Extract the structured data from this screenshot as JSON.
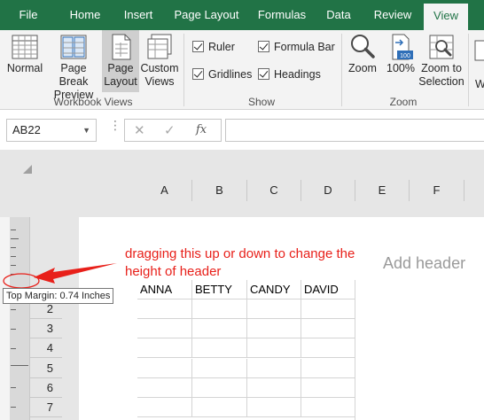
{
  "tabs": [
    {
      "label": "File"
    },
    {
      "label": "Home"
    },
    {
      "label": "Insert"
    },
    {
      "label": "Page Layout"
    },
    {
      "label": "Formulas"
    },
    {
      "label": "Data"
    },
    {
      "label": "Review"
    },
    {
      "label": "View",
      "active": true
    }
  ],
  "ribbon": {
    "workbook_views": {
      "group_label": "Workbook Views",
      "normal": {
        "line1": "Normal",
        "line2": ""
      },
      "page_break": {
        "line1": "Page Break",
        "line2": "Preview"
      },
      "page_layout": {
        "line1": "Page",
        "line2": "Layout"
      },
      "custom_views": {
        "line1": "Custom",
        "line2": "Views"
      }
    },
    "show": {
      "group_label": "Show",
      "ruler": "Ruler",
      "formula_bar": "Formula Bar",
      "gridlines": "Gridlines",
      "headings": "Headings"
    },
    "zoom": {
      "group_label": "Zoom",
      "zoom": "Zoom",
      "hundred": "100%",
      "zoom_sel": {
        "line1": "Zoom to",
        "line2": "Selection"
      },
      "badge": "100"
    }
  },
  "formula_bar": {
    "name_box": "AB22",
    "fx": "fx",
    "value": ""
  },
  "sheet": {
    "columns": [
      "A",
      "B",
      "C",
      "D",
      "E",
      "F"
    ],
    "rows": [
      "2",
      "3",
      "4",
      "5",
      "6",
      "7"
    ],
    "row1_values": [
      "ANNA",
      "BETTY",
      "CANDY",
      "DAVID"
    ],
    "add_header": "Add header",
    "tooltip": "Top Margin: 0.74 Inches",
    "annotation": "dragging this up or down to change the height of header"
  },
  "colors": {
    "excel_green": "#217346",
    "annotation_red": "#e8201a"
  }
}
